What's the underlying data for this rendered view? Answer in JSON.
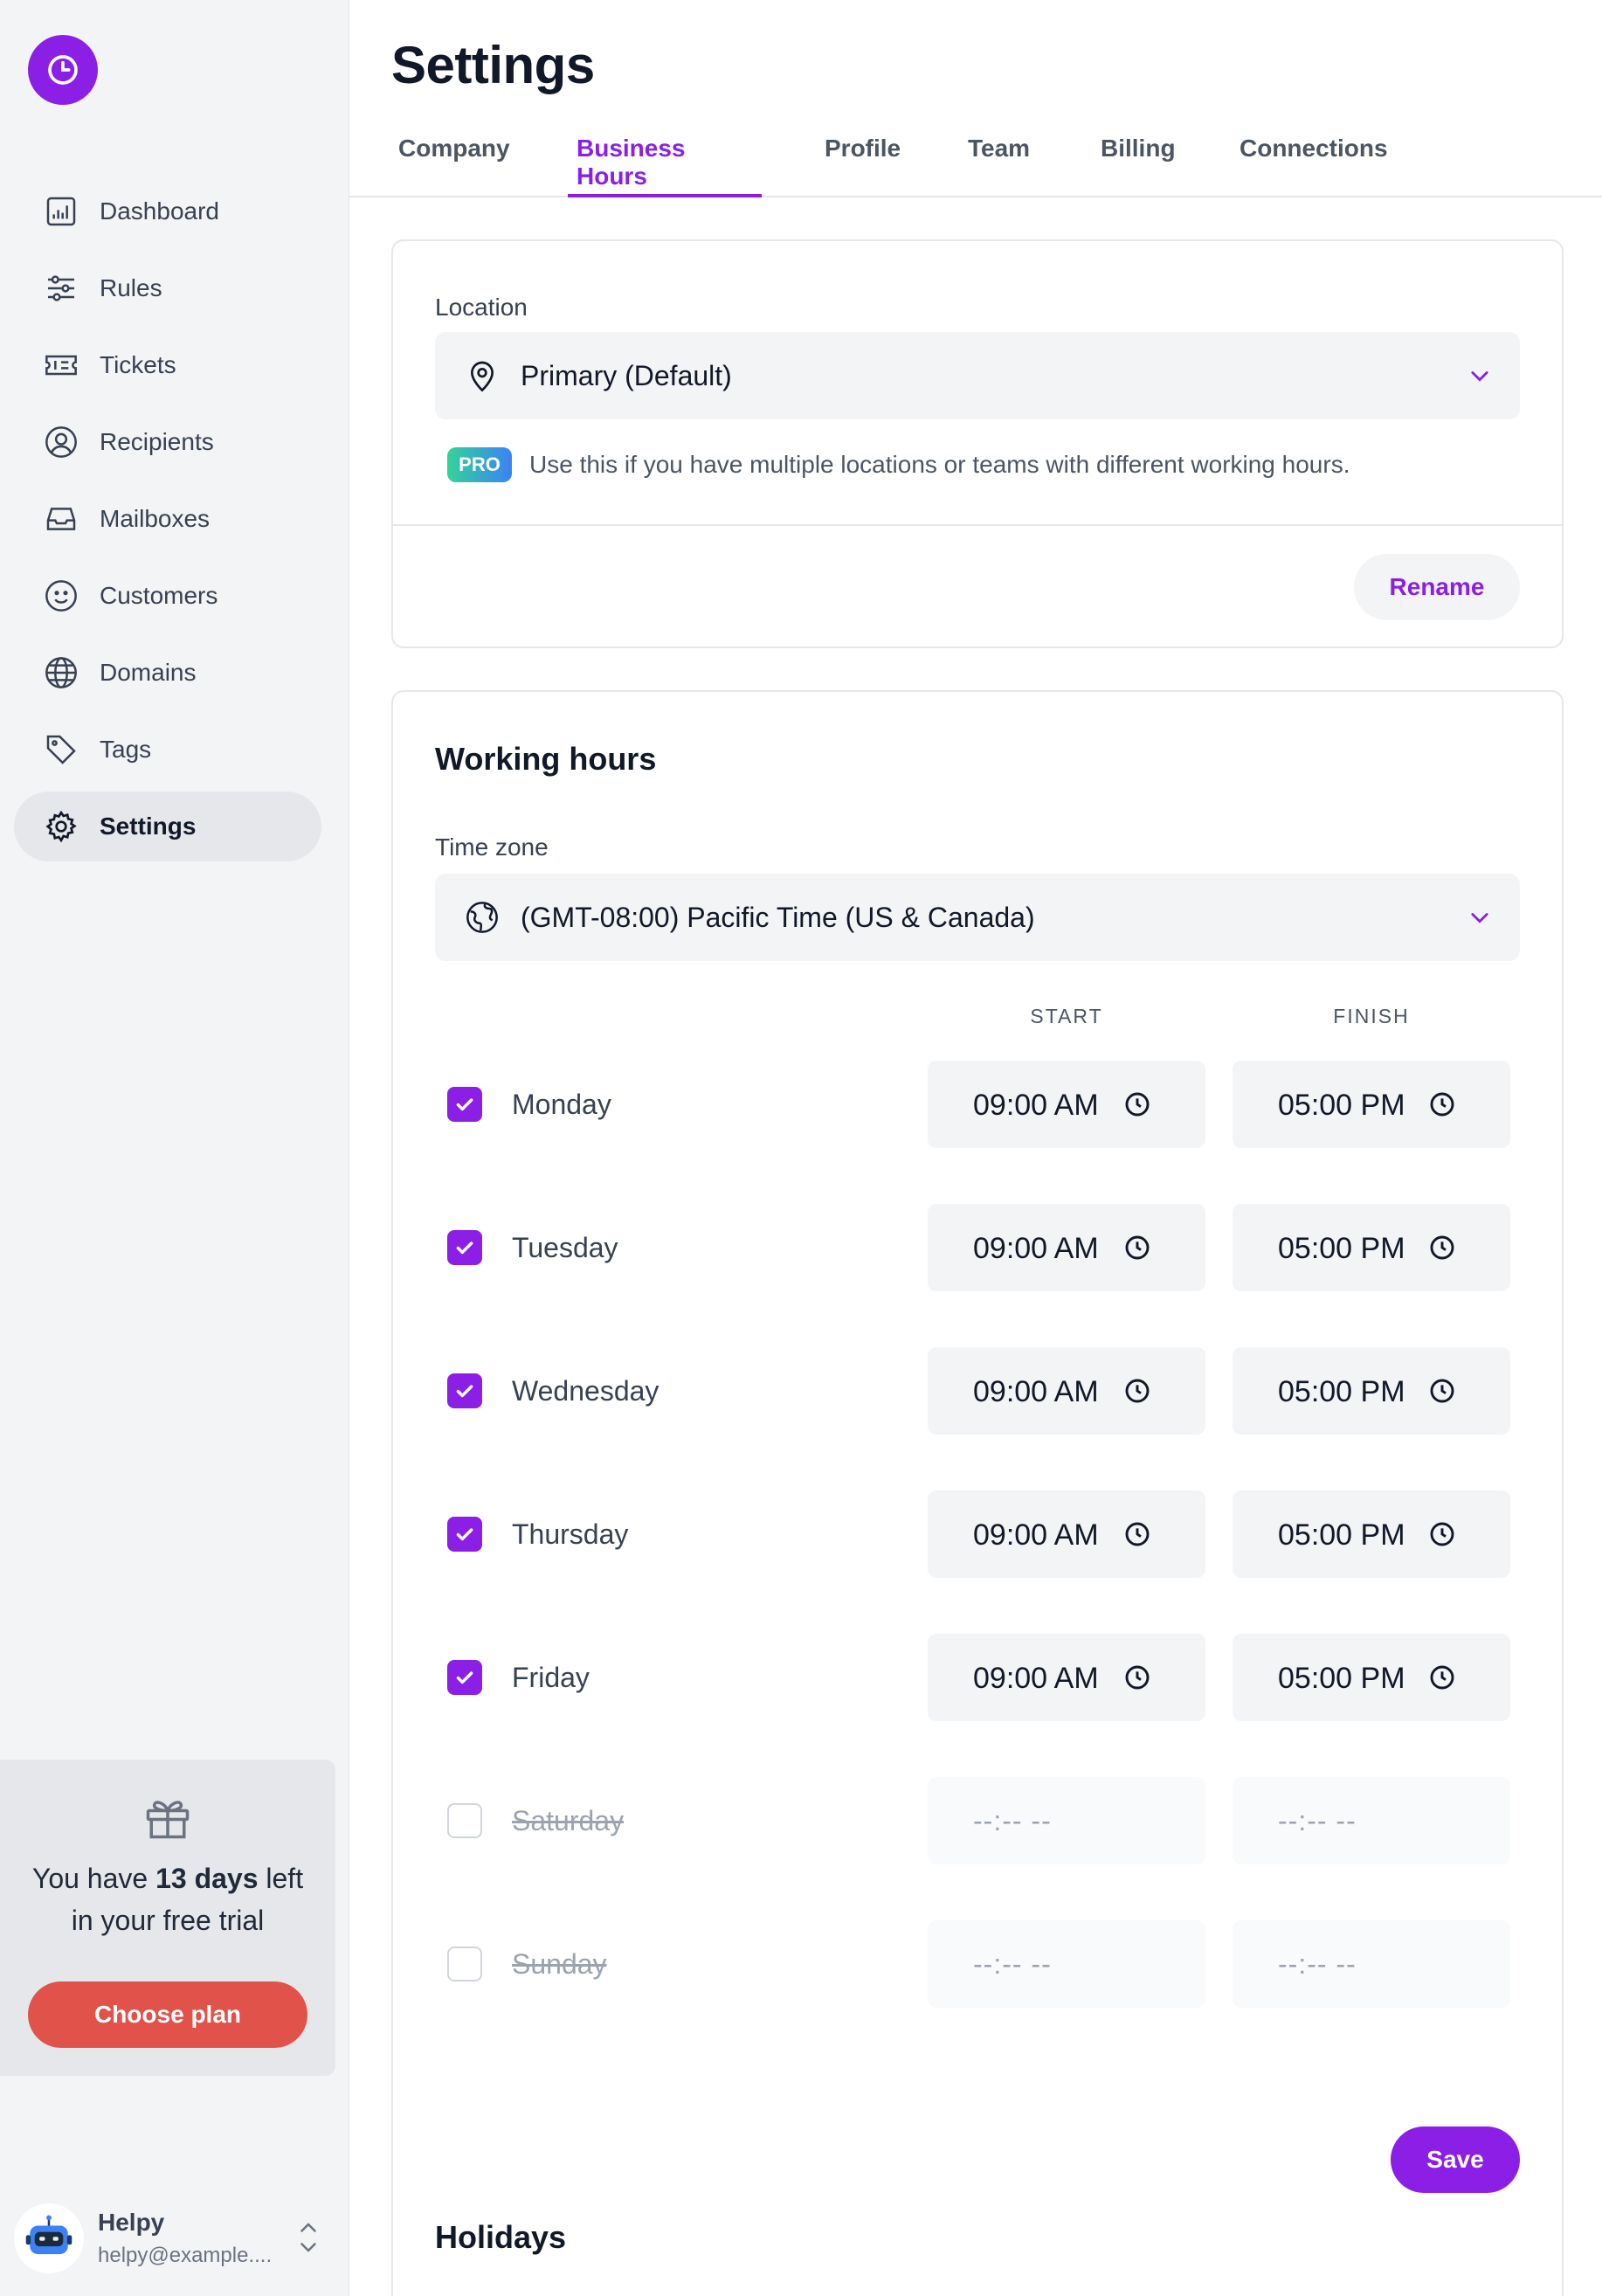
{
  "sidebar": {
    "logo_icon": "clock-icon",
    "items": [
      {
        "label": "Dashboard",
        "icon": "chart-bar-icon"
      },
      {
        "label": "Rules",
        "icon": "sliders-icon"
      },
      {
        "label": "Tickets",
        "icon": "ticket-icon"
      },
      {
        "label": "Recipients",
        "icon": "user-circle-icon"
      },
      {
        "label": "Mailboxes",
        "icon": "inbox-icon"
      },
      {
        "label": "Customers",
        "icon": "smiley-icon"
      },
      {
        "label": "Domains",
        "icon": "globe-icon"
      },
      {
        "label": "Tags",
        "icon": "tag-icon"
      },
      {
        "label": "Settings",
        "icon": "gear-icon",
        "active": true
      }
    ],
    "trial": {
      "prefix": "You have ",
      "days": "13 days",
      "suffix_line1": " left",
      "line2": "in your free trial",
      "button": "Choose plan"
    },
    "user": {
      "name": "Helpy",
      "email": "helpy@example...."
    }
  },
  "page": {
    "title": "Settings",
    "tabs": [
      {
        "label": "Company"
      },
      {
        "label": "Business Hours",
        "active": true
      },
      {
        "label": "Profile"
      },
      {
        "label": "Team"
      },
      {
        "label": "Billing"
      },
      {
        "label": "Connections"
      }
    ]
  },
  "location": {
    "label": "Location",
    "value": "Primary (Default)",
    "pro_badge": "PRO",
    "note": "Use this if you have multiple locations or teams with different working hours.",
    "rename_button": "Rename"
  },
  "working_hours": {
    "title": "Working hours",
    "timezone_label": "Time zone",
    "timezone_value": "(GMT-08:00) Pacific Time (US & Canada)",
    "col_start": "START",
    "col_finish": "FINISH",
    "days": [
      {
        "name": "Monday",
        "enabled": true,
        "start": "09:00 AM",
        "finish": "05:00 PM"
      },
      {
        "name": "Tuesday",
        "enabled": true,
        "start": "09:00 AM",
        "finish": "05:00 PM"
      },
      {
        "name": "Wednesday",
        "enabled": true,
        "start": "09:00 AM",
        "finish": "05:00 PM"
      },
      {
        "name": "Thursday",
        "enabled": true,
        "start": "09:00 AM",
        "finish": "05:00 PM"
      },
      {
        "name": "Friday",
        "enabled": true,
        "start": "09:00 AM",
        "finish": "05:00 PM"
      },
      {
        "name": "Saturday",
        "enabled": false,
        "start": "--:-- --",
        "finish": "--:-- --"
      },
      {
        "name": "Sunday",
        "enabled": false,
        "start": "--:-- --",
        "finish": "--:-- --"
      }
    ],
    "save_button": "Save"
  },
  "holidays": {
    "title": "Holidays"
  },
  "colors": {
    "accent": "#8b1fe6",
    "trial_button": "#e0524a",
    "sidebar_bg": "#f3f4f6"
  }
}
